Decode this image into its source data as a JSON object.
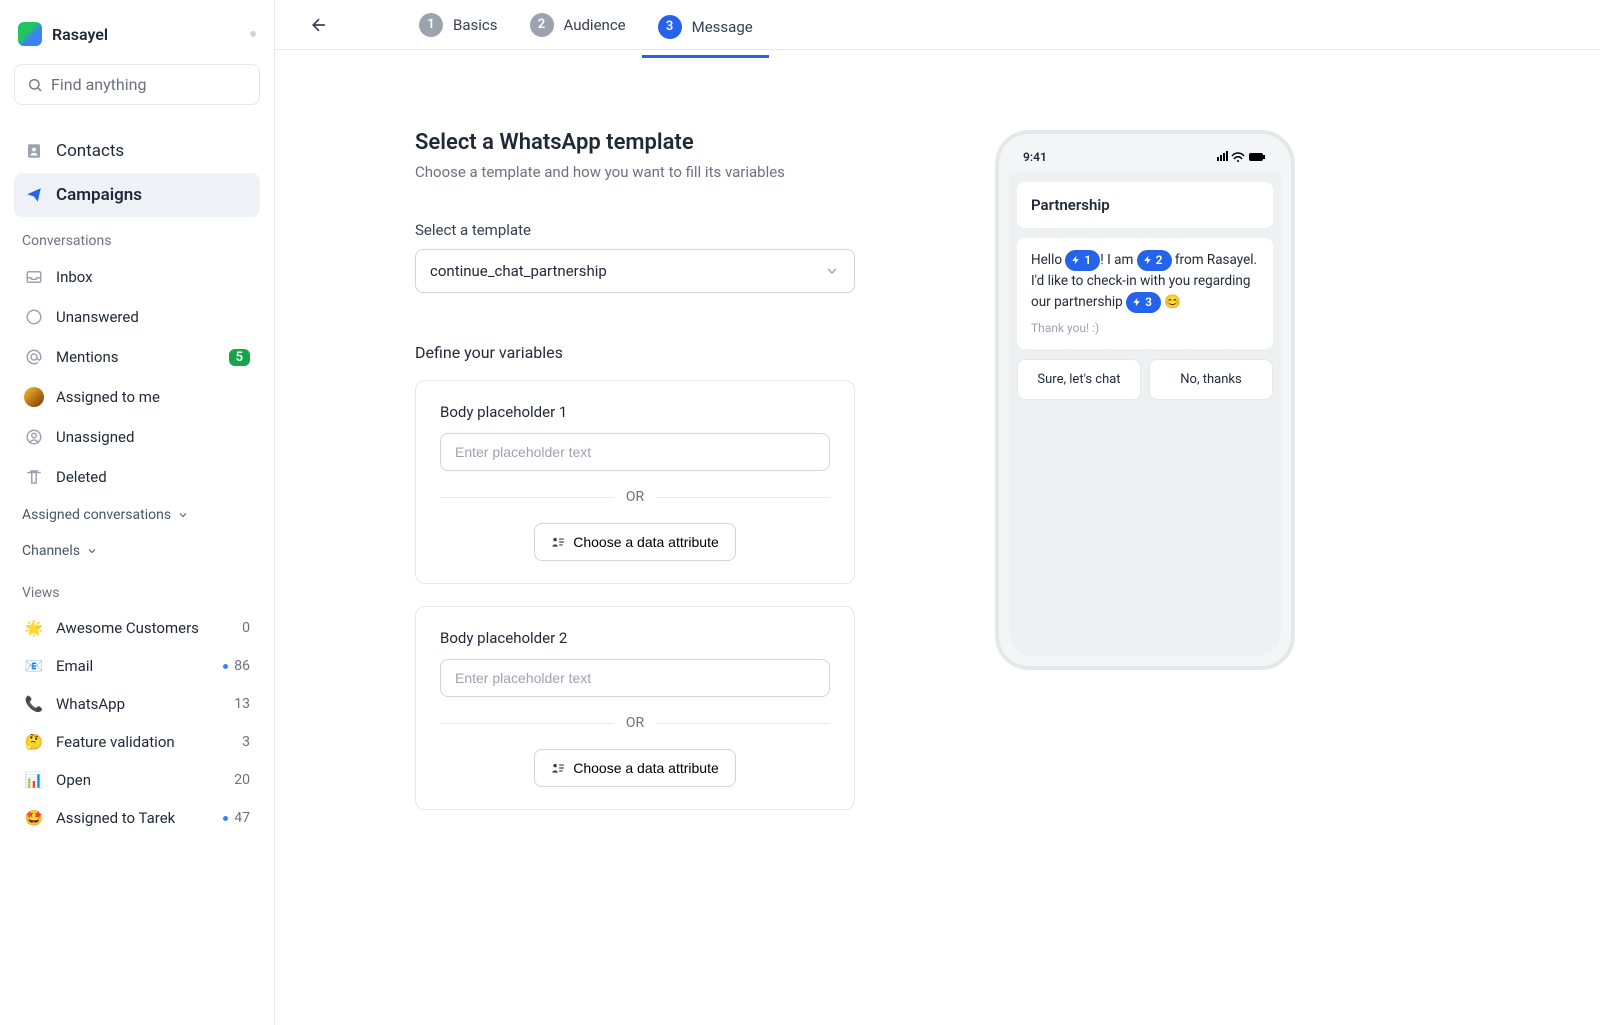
{
  "brand": {
    "name": "Rasayel"
  },
  "search": {
    "placeholder": "Find anything"
  },
  "nav": {
    "contacts": "Contacts",
    "campaigns": "Campaigns",
    "conversations_label": "Conversations",
    "inbox": "Inbox",
    "unanswered": "Unanswered",
    "mentions": {
      "label": "Mentions",
      "count": "5"
    },
    "assigned_to_me": "Assigned to me",
    "unassigned": "Unassigned",
    "deleted": "Deleted",
    "assigned_conversations": "Assigned conversations",
    "channels": "Channels",
    "views_label": "Views"
  },
  "views": [
    {
      "emoji": "🌟",
      "label": "Awesome Customers",
      "count": "0",
      "dot": false
    },
    {
      "emoji": "📧",
      "label": "Email",
      "count": "86",
      "dot": true
    },
    {
      "emoji": "📞",
      "label": "WhatsApp",
      "count": "13",
      "dot": false
    },
    {
      "emoji": "🤔",
      "label": "Feature validation",
      "count": "3",
      "dot": false
    },
    {
      "emoji": "📊",
      "label": "Open",
      "count": "20",
      "dot": false
    },
    {
      "emoji": "🤩",
      "label": "Assigned to Tarek",
      "count": "47",
      "dot": true
    }
  ],
  "steps": [
    {
      "num": "1",
      "label": "Basics"
    },
    {
      "num": "2",
      "label": "Audience"
    },
    {
      "num": "3",
      "label": "Message"
    }
  ],
  "form": {
    "title": "Select a WhatsApp template",
    "subtitle": "Choose a template and how you want to fill its variables",
    "select_label": "Select a template",
    "select_value": "continue_chat_partnership",
    "define_label": "Define your variables",
    "placeholder_input": "Enter placeholder text",
    "or": "OR",
    "attr_btn": "Choose a data attribute",
    "cards": [
      {
        "title": "Body placeholder 1"
      },
      {
        "title": "Body placeholder 2"
      }
    ]
  },
  "preview": {
    "time": "9:41",
    "header": "Partnership",
    "body_parts": {
      "p1": "Hello ",
      "p2": "! I am ",
      "p3": " from Rasayel. I'd like to check-in with you regarding our partnership ",
      "p4": " 😊"
    },
    "vars": {
      "v1": "1",
      "v2": "2",
      "v3": "3"
    },
    "footer": "Thank you! :)",
    "buttons": [
      "Sure, let's chat",
      "No, thanks"
    ]
  }
}
